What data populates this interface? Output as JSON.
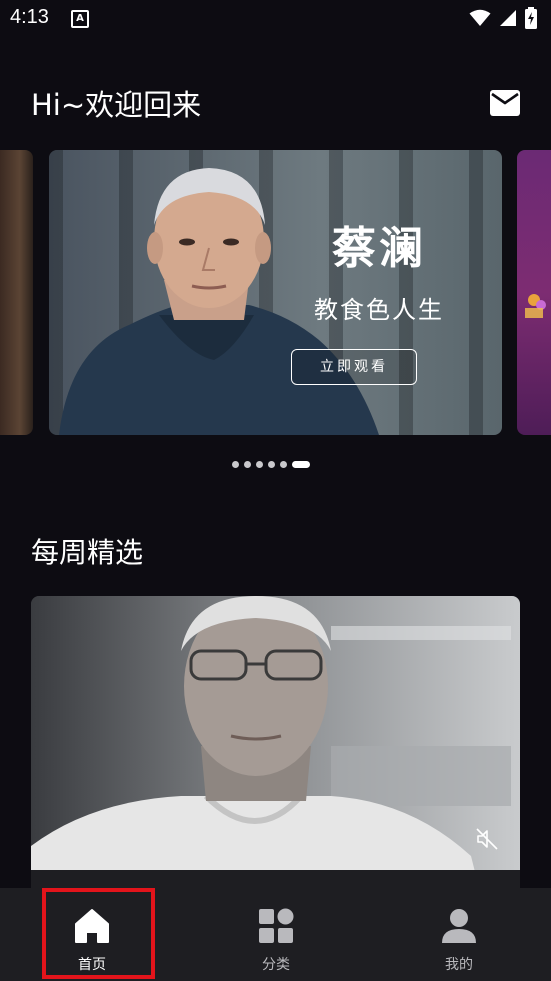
{
  "status_bar": {
    "time": "4:13",
    "icons": [
      "a-notification-icon",
      "wifi-icon",
      "cellular-signal-icon",
      "battery-charging-icon"
    ]
  },
  "header": {
    "greeting": "Hi~欢迎回来",
    "mail_icon": "mail-icon"
  },
  "carousel": {
    "banner": {
      "title": "蔡澜",
      "subtitle": "教食色人生",
      "button_label": "立即观看"
    },
    "page_count": 6,
    "active_index": 5
  },
  "weekly": {
    "title": "每周精选",
    "mute_icon": "volume-muted-icon"
  },
  "bottom_nav": {
    "items": [
      {
        "label": "首页",
        "icon": "home-icon",
        "active": true
      },
      {
        "label": "分类",
        "icon": "category-grid-icon",
        "active": false
      },
      {
        "label": "我的",
        "icon": "user-icon",
        "active": false
      }
    ]
  },
  "colors": {
    "background": "#0d0c12",
    "nav_background": "#1e1e22",
    "highlight": "#e3141b"
  }
}
